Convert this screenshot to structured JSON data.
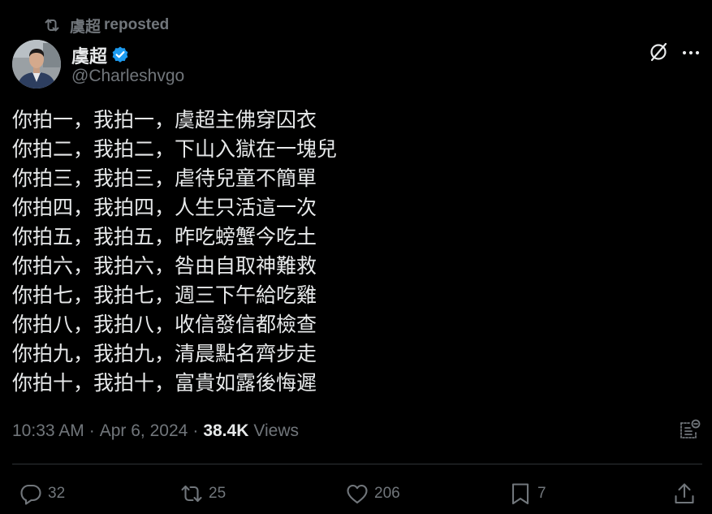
{
  "repost_banner": {
    "reposter_name": "虞超",
    "label": "reposted",
    "icon": "repost-icon"
  },
  "author": {
    "name": "虞超",
    "handle": "@Charleshvgo",
    "verified": true,
    "verified_color": "#1d9bf0"
  },
  "post": {
    "lines": [
      "你拍一，我拍一，虞超主佛穿囚衣",
      "你拍二，我拍二，下山入獄在一塊兒",
      "你拍三，我拍三，虐待兒童不簡單",
      "你拍四，我拍四，人生只活這一次",
      "你拍五，我拍五，昨吃螃蟹今吃土",
      "你拍六，我拍六，咎由自取神難救",
      "你拍七，我拍七，週三下午給吃雞",
      "你拍八，我拍八，收信發信都檢查",
      "你拍九，我拍九，清晨點名齊步走",
      "你拍十，我拍十，富貴如露後悔遲"
    ]
  },
  "meta": {
    "time": "10:33 AM",
    "separator": "·",
    "date": "Apr 6, 2024",
    "views_count": "38.4K",
    "views_label": "Views"
  },
  "actions": {
    "replies": "32",
    "reposts": "25",
    "likes": "206",
    "bookmarks": "7"
  },
  "colors": {
    "background": "#000000",
    "text_primary": "#e7e9ea",
    "text_secondary": "#71767b",
    "divider": "#2f3336",
    "accent": "#1d9bf0"
  }
}
